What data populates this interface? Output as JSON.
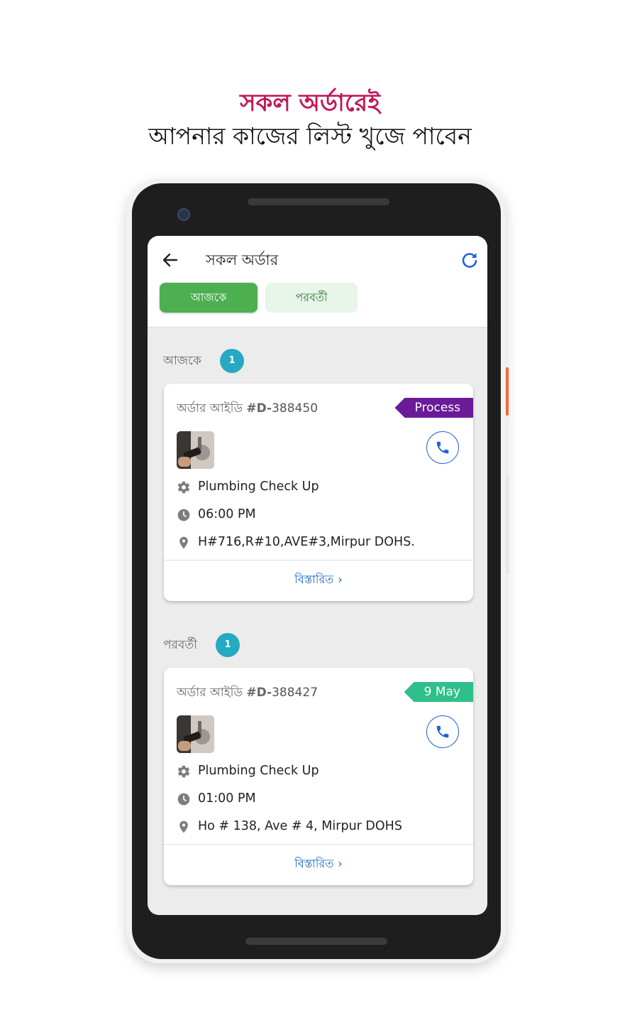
{
  "headline": {
    "line1": "সকল অর্ডারেই",
    "line2": "আপনার কাজের লিস্ট খুজে পাবেন"
  },
  "appbar": {
    "title": "সকল অর্ডার",
    "tabs": [
      {
        "label": "আজকে",
        "active": true
      },
      {
        "label": "পরবর্তী",
        "active": false
      }
    ]
  },
  "sections": [
    {
      "label": "আজকে",
      "count": "1",
      "order": {
        "id_label": "অর্ডার আইডি",
        "id_hash": "#",
        "id_prefix": "D-",
        "id_number": "388450",
        "badge": "Process",
        "badge_color": "#6a1b9a",
        "service": "Plumbing Check Up",
        "time": "06:00 PM",
        "address": "H#716,R#10,AVE#3,Mirpur DOHS.",
        "details": "বিস্তারিত"
      }
    },
    {
      "label": "পরবর্তী",
      "count": "1",
      "order": {
        "id_label": "অর্ডার আইডি",
        "id_hash": "#",
        "id_prefix": "D-",
        "id_number": "388427",
        "badge": "9 May",
        "badge_color": "#2ebf8a",
        "service": "Plumbing Check Up",
        "time": "01:00 PM",
        "address": "Ho # 138, Ave # 4, Mirpur DOHS",
        "details": "বিস্তারিত"
      }
    }
  ],
  "icons": {
    "back": "arrow-left-icon",
    "refresh": "refresh-icon",
    "call": "phone-icon",
    "service": "gear-icon",
    "time": "clock-icon",
    "address": "location-pin-icon"
  },
  "colors": {
    "headline_accent": "#c2185b",
    "tab_active": "#4caf50",
    "tab_inactive_bg": "#e8f5e9",
    "count_badge": "#26a9c2",
    "link": "#1565c0"
  }
}
